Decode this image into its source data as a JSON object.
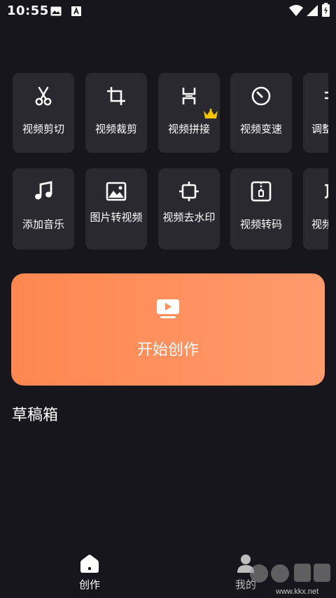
{
  "status_bar": {
    "time": "10:55"
  },
  "tools": [
    {
      "label": "视频剪切",
      "icon": "scissors-icon"
    },
    {
      "label": "视频裁剪",
      "icon": "crop-icon"
    },
    {
      "label": "视频拼接",
      "icon": "merge-icon"
    },
    {
      "label": "视频变速",
      "icon": "speed-icon"
    },
    {
      "label": "调整",
      "icon": "adjust-icon"
    },
    {
      "label": "添加音乐",
      "icon": "music-note-icon"
    },
    {
      "label": "图片转视频",
      "icon": "image-icon"
    },
    {
      "label": "视频去水印",
      "icon": "remove-watermark-icon",
      "badge": "crown-icon"
    },
    {
      "label": "视频转码",
      "icon": "zip-file-icon"
    },
    {
      "label": "视频",
      "icon": "clip-icon"
    }
  ],
  "start": {
    "label": "开始创作",
    "icon": "video-play-icon"
  },
  "drafts": {
    "title": "草稿箱"
  },
  "bottom_nav": [
    {
      "label": "创作",
      "icon": "home-icon",
      "active": true
    },
    {
      "label": "我的",
      "icon": "person-icon",
      "active": false
    }
  ],
  "watermark": {
    "url": "www.kkx.net"
  },
  "colors": {
    "background": "#17161c",
    "card": "#2a292f",
    "accent_start": "#ff8750",
    "accent_end": "#ff9a6c",
    "crown": "#f5c400"
  }
}
